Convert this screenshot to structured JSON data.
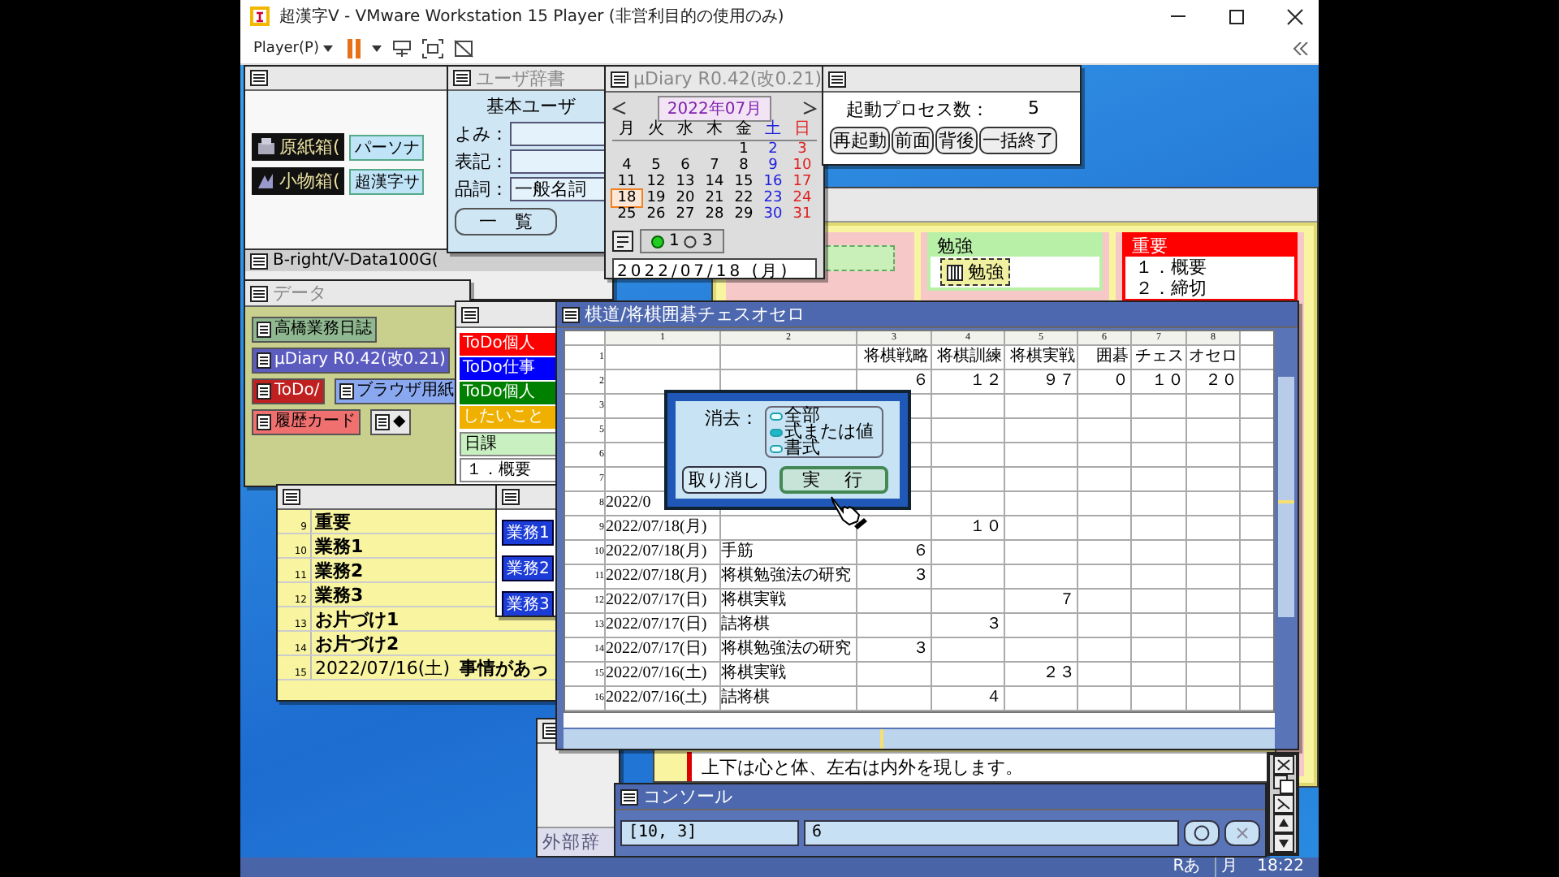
{
  "vm": {
    "title": "超漢字V - VMware Workstation 15 Player (非営利目的の使用のみ)",
    "menu": "Player(P)"
  },
  "btron_window": {
    "items": [
      {
        "label": "原紙箱(",
        "tag": "パーソナ"
      },
      {
        "label": "小物箱(",
        "tag": "超漢字サ"
      }
    ],
    "subwindow_title": "B-right/V-Data100G("
  },
  "dictionary_window": {
    "title": "ユーザ辞書",
    "heading": "基本ユーザ",
    "fields": [
      {
        "label": "よみ："
      },
      {
        "label": "表記："
      },
      {
        "label": "品詞：",
        "value": "一般名詞"
      }
    ],
    "button": "一　覧"
  },
  "diary_window": {
    "title": "μDiary R0.42(改0.21)",
    "month": "2022年07月",
    "weekdays": [
      "月",
      "火",
      "水",
      "木",
      "金",
      "土",
      "日"
    ],
    "weeks": [
      [
        {
          "d": "1",
          "selected": false
        },
        {
          "d": "2",
          "selected": false
        },
        {
          "d": "3",
          "selected": false
        }
      ],
      [
        {
          "d": "4",
          "selected": false
        },
        {
          "d": "5",
          "selected": false
        },
        {
          "d": "6",
          "selected": false
        },
        {
          "d": "7",
          "selected": false
        },
        {
          "d": "8",
          "selected": false
        },
        {
          "d": "9",
          "selected": false
        },
        {
          "d": "10",
          "selected": false
        }
      ],
      [
        {
          "d": "11",
          "selected": false
        },
        {
          "d": "12",
          "selected": false
        },
        {
          "d": "13",
          "selected": false
        },
        {
          "d": "14",
          "selected": false
        },
        {
          "d": "15",
          "selected": false
        },
        {
          "d": "16",
          "selected": false
        },
        {
          "d": "17",
          "selected": false
        }
      ],
      [
        {
          "d": "18",
          "selected": true
        },
        {
          "d": "19",
          "selected": false
        },
        {
          "d": "20",
          "selected": false
        },
        {
          "d": "21",
          "selected": false
        },
        {
          "d": "22",
          "selected": false
        },
        {
          "d": "23",
          "selected": false
        },
        {
          "d": "24",
          "selected": false
        }
      ],
      [
        {
          "d": "25",
          "selected": false
        },
        {
          "d": "26",
          "selected": false
        },
        {
          "d": "27",
          "selected": false
        },
        {
          "d": "28",
          "selected": false
        },
        {
          "d": "29",
          "selected": false
        },
        {
          "d": "30",
          "selected": false
        },
        {
          "d": "31",
          "selected": false
        }
      ]
    ],
    "counts": [
      "1",
      "3"
    ],
    "date": "2022/07/18 (月)"
  },
  "process_window": {
    "label": "起動プロセス数：",
    "count": "5",
    "buttons": [
      "再起動",
      "前面",
      "背後",
      "一括終了"
    ]
  },
  "board": {
    "cards": [
      {
        "title": "勉強",
        "color": "#b8f0a8",
        "item": "勉強"
      },
      {
        "title": "重要",
        "color": "#ff0000",
        "lines": [
          "１．概要",
          "２．締切"
        ]
      }
    ]
  },
  "note_window": {
    "text": "上下は心と体、左右は内外を現します。"
  },
  "data_window": {
    "title": "データ",
    "items": [
      {
        "label": "高橋業務日誌",
        "color": "#90b890"
      },
      {
        "label": "μDiary R0.42(改0.21)",
        "color": "#5c5cc0"
      },
      {
        "label": "ToDo/",
        "color": "#c02020"
      },
      {
        "label": "ブラウザ用紙",
        "color": "#8aa8f0"
      },
      {
        "label": "履歴カード",
        "color": "#f07070"
      },
      {
        "label": "◆",
        "color": "#e8e8e8"
      }
    ]
  },
  "paper_window": {
    "items": [
      {
        "label": "ToDo個人",
        "color": "#ff0000"
      },
      {
        "label": "ToDo仕事",
        "color": "#0000ff"
      },
      {
        "label": "ToDo個人",
        "color": "#008000"
      },
      {
        "label": "したいこと",
        "color": "#f0b000"
      }
    ],
    "section": "日課",
    "lines": [
      "１．概要"
    ]
  },
  "task_table": {
    "rows": [
      {
        "num": "9",
        "text": "重要"
      },
      {
        "num": "10",
        "text": "業務1"
      },
      {
        "num": "11",
        "text": "業務2"
      },
      {
        "num": "12",
        "text": "業務3"
      },
      {
        "num": "13",
        "text": "お片づけ1"
      },
      {
        "num": "14",
        "text": "お片づけ2"
      },
      {
        "num": "15",
        "date": "2022/07/16(土)",
        "text": "事情があっ"
      }
    ]
  },
  "job_window": {
    "buttons": [
      "業務1",
      "業務2",
      "業務3"
    ]
  },
  "sheet": {
    "title": "棋道/将棋囲碁チェスオセロ",
    "columns": [
      "1",
      "2",
      "3",
      "4",
      "5",
      "6",
      "7",
      "8"
    ],
    "rows": [
      {
        "num": "1",
        "cells": {
          "c3": "将棋戦略",
          "c4": "将棋訓練",
          "c5": "将棋実戦",
          "c6": "囲碁",
          "c7": "チェス",
          "c8": "オセロ"
        }
      },
      {
        "num": "2",
        "cells": {
          "c3": "６",
          "c4": "１２",
          "c5": "９７",
          "c6": "０",
          "c7": "１０",
          "c8": "２０"
        }
      },
      {
        "num": "3"
      },
      {
        "num": "5"
      },
      {
        "num": "6"
      },
      {
        "num": "7"
      },
      {
        "num": "8",
        "cells": {
          "c1": "2022/0"
        }
      },
      {
        "num": "9",
        "cells": {
          "c1": "2022/07/18(月)",
          "c4": "１０"
        }
      },
      {
        "num": "10",
        "cells": {
          "c1": "2022/07/18(月)",
          "c2": "手筋",
          "c3": "６"
        }
      },
      {
        "num": "11",
        "cells": {
          "c1": "2022/07/18(月)",
          "c2": "将棋勉強法の研究",
          "c3": "３"
        }
      },
      {
        "num": "12",
        "cells": {
          "c1": "2022/07/17(日)",
          "c2": "将棋実戦",
          "c5": "７"
        }
      },
      {
        "num": "13",
        "cells": {
          "c1": "2022/07/17(日)",
          "c2": "詰将棋",
          "c4": "３"
        }
      },
      {
        "num": "14",
        "cells": {
          "c1": "2022/07/17(日)",
          "c2": "将棋勉強法の研究",
          "c3": "３"
        }
      },
      {
        "num": "15",
        "cells": {
          "c1": "2022/07/16(土)",
          "c2": "将棋実戦",
          "c5": "２３"
        }
      },
      {
        "num": "16",
        "cells": {
          "c1": "2022/07/16(土)",
          "c2": "詰将棋",
          "c4": "４"
        }
      }
    ]
  },
  "dialog": {
    "label": "消去：",
    "options": [
      {
        "label": "全部",
        "selected": false
      },
      {
        "label": "式または値",
        "selected": true
      },
      {
        "label": "書式",
        "selected": false
      }
    ],
    "buttons": [
      {
        "label": "取り消し",
        "selected": false
      },
      {
        "label": "実　行",
        "selected": true
      }
    ]
  },
  "console": {
    "title": "コンソール",
    "position": "[10, 3]",
    "value": "6"
  },
  "ext_window": {
    "tab": "外部辞"
  },
  "taskbar": {
    "ime": "Rあ",
    "day": "月",
    "time": "18:22"
  }
}
